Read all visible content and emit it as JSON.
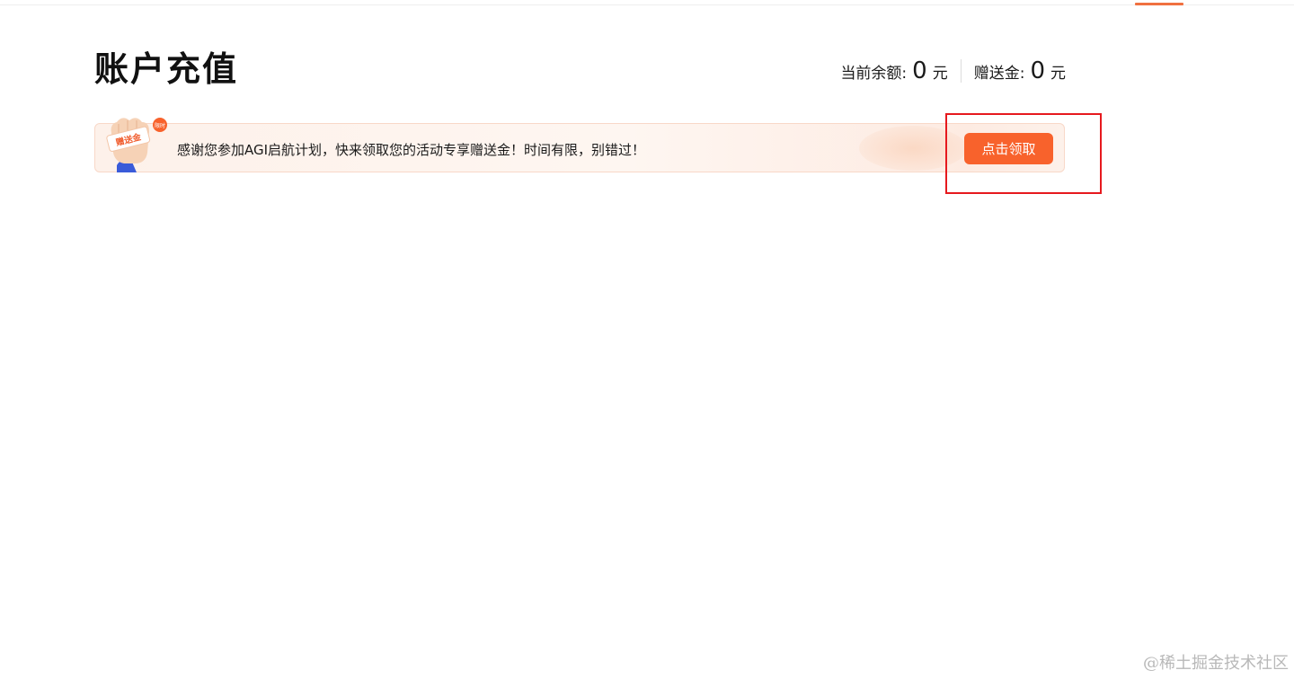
{
  "header": {
    "title": "账户充值"
  },
  "balance": {
    "current_label": "当前余额:",
    "current_value": "0",
    "current_unit": "元",
    "bonus_label": "赠送金:",
    "bonus_value": "0",
    "bonus_unit": "元"
  },
  "banner": {
    "badge_label": "赠送金",
    "badge_tag": "限时",
    "message": "感谢您参加AGI启航计划，快来领取您的活动专享赠送金！时间有限，别错过！",
    "claim_button_label": "点击领取"
  },
  "watermark": "@稀土掘金技术社区",
  "colors": {
    "accent": "#f8622c",
    "highlight": "#e6191e",
    "banner_bg": "#fdf1ea"
  }
}
